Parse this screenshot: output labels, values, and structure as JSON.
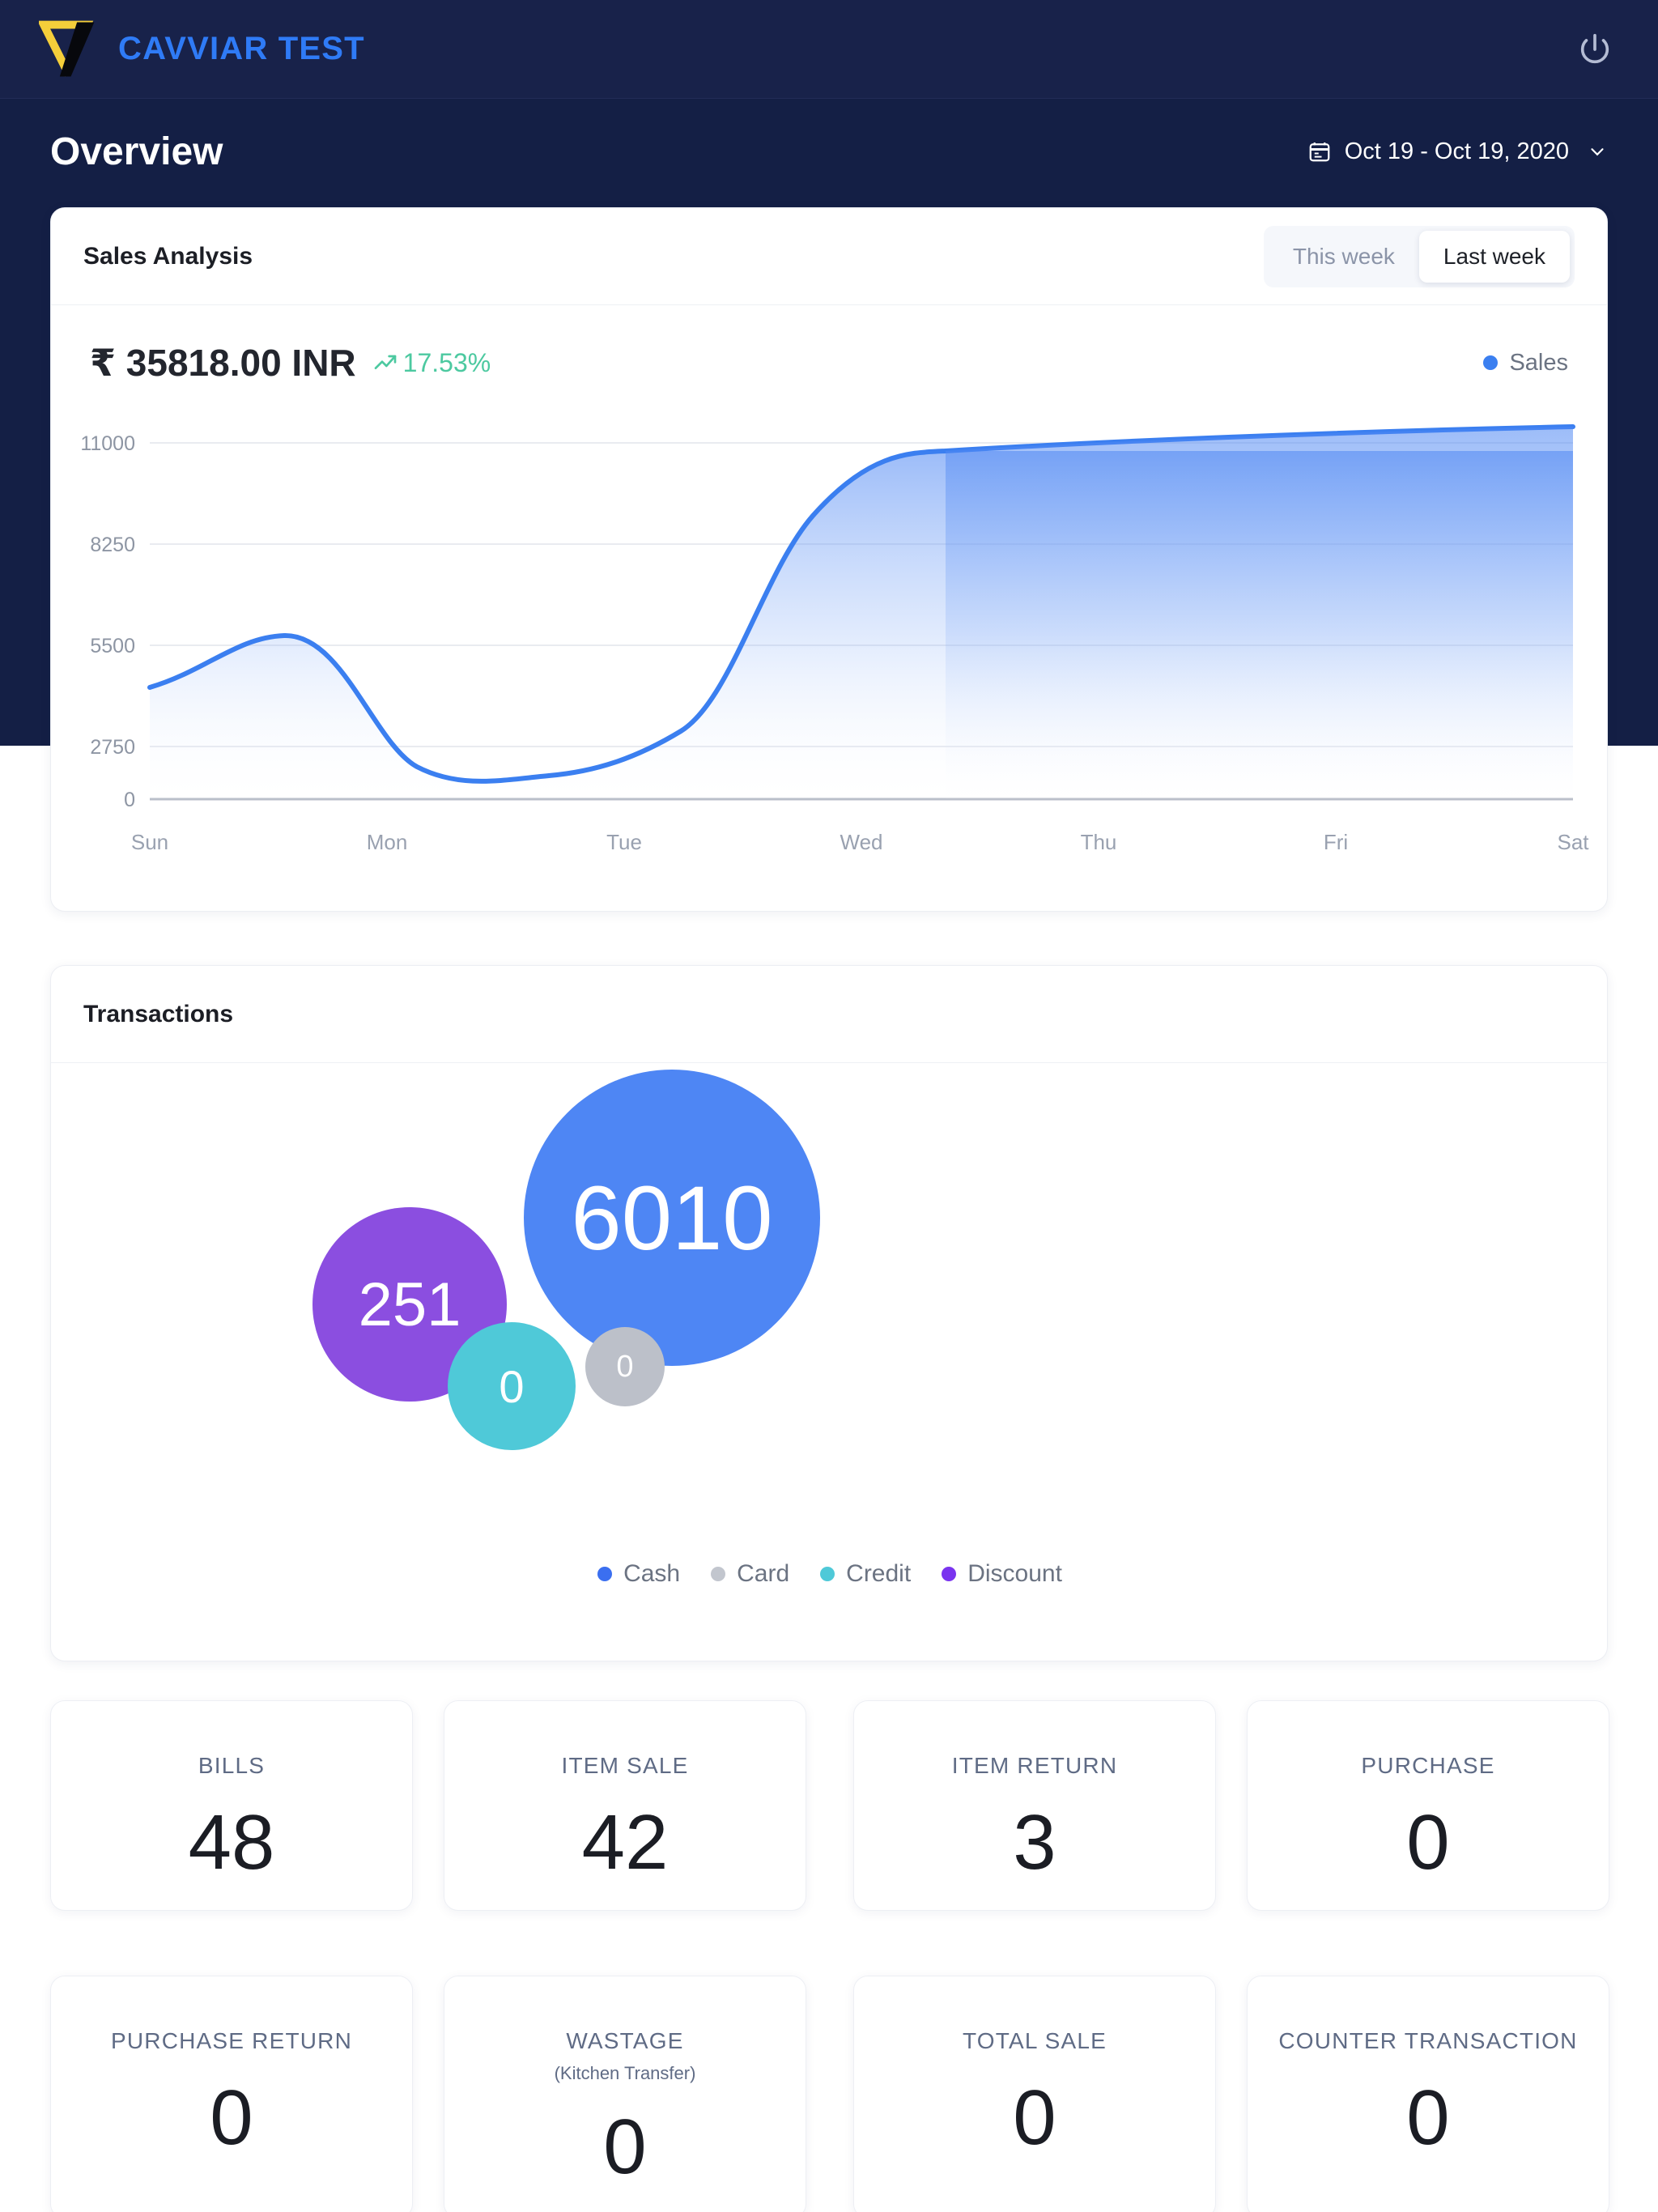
{
  "topbar": {
    "brand_name": "CAVVIAR TEST",
    "logo_icon": "cavviar-v-logo",
    "power_icon": "power-icon",
    "brand_color": "#2f7bf6",
    "logo_color": "#f4ce3a",
    "background": "#18224a"
  },
  "header": {
    "page_title": "Overview",
    "date_range": "Oct 19 - Oct 19, 2020",
    "calendar_icon": "calendar-icon",
    "chevron_icon": "chevron-down-icon"
  },
  "sales": {
    "title": "Sales Analysis",
    "tabs": [
      {
        "label": "This week",
        "active": false
      },
      {
        "label": "Last week",
        "active": true
      }
    ],
    "amount": "₹ 35818.00 INR",
    "delta": "17.53%",
    "delta_icon": "trend-up-icon",
    "delta_color": "#4cc9a0",
    "legend_label": "Sales",
    "legend_color": "#3b7ff0"
  },
  "transactions": {
    "title": "Transactions",
    "bubbles": [
      {
        "label": "Cash",
        "value": "6010",
        "color": "#4e86f4",
        "radius": 105,
        "cx": 645,
        "cy": 874,
        "font": 66
      },
      {
        "label": "Discount",
        "value": "251",
        "color": "#8b4ee0",
        "radius": 68,
        "cx": 385,
        "cy": 981,
        "font": 46
      },
      {
        "label": "Credit",
        "value": "0",
        "color": "#4fc9d8",
        "radius": 45,
        "cx": 551,
        "cy": 1051,
        "font": 34
      },
      {
        "label": "Card",
        "value": "0",
        "color": "#bcc0c9",
        "radius": 28,
        "cx": 697,
        "cy": 1033,
        "font": 24
      }
    ],
    "legend": [
      {
        "label": "Cash",
        "color": "#3b6ff0"
      },
      {
        "label": "Card",
        "color": "#c2c6ce"
      },
      {
        "label": "Credit",
        "color": "#4fc9d8"
      },
      {
        "label": "Discount",
        "color": "#7a34ef"
      }
    ]
  },
  "stats": [
    {
      "label": "BILLS",
      "sub": "",
      "value": "48"
    },
    {
      "label": "ITEM SALE",
      "sub": "",
      "value": "42"
    },
    {
      "label": "ITEM RETURN",
      "sub": "",
      "value": "3"
    },
    {
      "label": "PURCHASE",
      "sub": "",
      "value": "0"
    },
    {
      "label": "PURCHASE RETURN",
      "sub": "",
      "value": "0"
    },
    {
      "label": "WASTAGE",
      "sub": "(Kitchen Transfer)",
      "value": "0"
    },
    {
      "label": "TOTAL SALE",
      "sub": "",
      "value": "0"
    },
    {
      "label": "COUNTER TRANSACTION",
      "sub": "",
      "value": "0"
    }
  ],
  "chart_data": {
    "type": "area",
    "title": "Sales Analysis",
    "xlabel": "",
    "ylabel": "",
    "categories": [
      "Sun",
      "Mon",
      "Tue",
      "Wed",
      "Thu",
      "Fri",
      "Sat"
    ],
    "series": [
      {
        "name": "Sales",
        "values": [
          3800,
          5150,
          1750,
          1600,
          3050,
          9400,
          9900
        ],
        "color": "#3b7ff0"
      }
    ],
    "ylim": [
      0,
      11000
    ],
    "yticks": [
      0,
      2750,
      5500,
      8250,
      11000
    ],
    "ytick_labels": [
      "0",
      "2750",
      "5500",
      "8250",
      "11000"
    ],
    "grid": true,
    "legend_position": "top-right",
    "curve": "smooth",
    "fill": "gradient"
  }
}
